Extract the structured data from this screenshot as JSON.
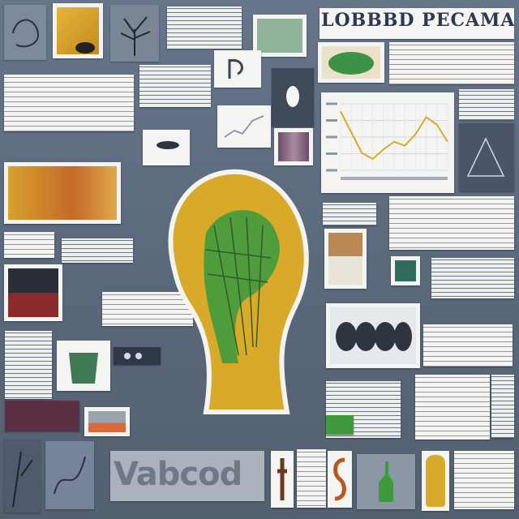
{
  "poster": {
    "title": "LOBBBD PECAMAN",
    "bottom_word": "Vabcod",
    "palette": {
      "background": "#5d6b7d",
      "paper": "#f4f5f2",
      "mustard": "#d9a92a",
      "green": "#3f9a3e",
      "ink": "#2d3a4e",
      "red": "#8a2b2b"
    }
  },
  "chart_data": {
    "type": "line",
    "x": [
      0,
      1,
      2,
      3,
      4,
      5,
      6,
      7,
      8,
      9,
      10
    ],
    "values": [
      62,
      40,
      18,
      12,
      22,
      30,
      26,
      38,
      56,
      48,
      30
    ],
    "ylim": [
      0,
      70
    ],
    "grid": true,
    "title": "",
    "xlabel": "",
    "ylabel": ""
  }
}
